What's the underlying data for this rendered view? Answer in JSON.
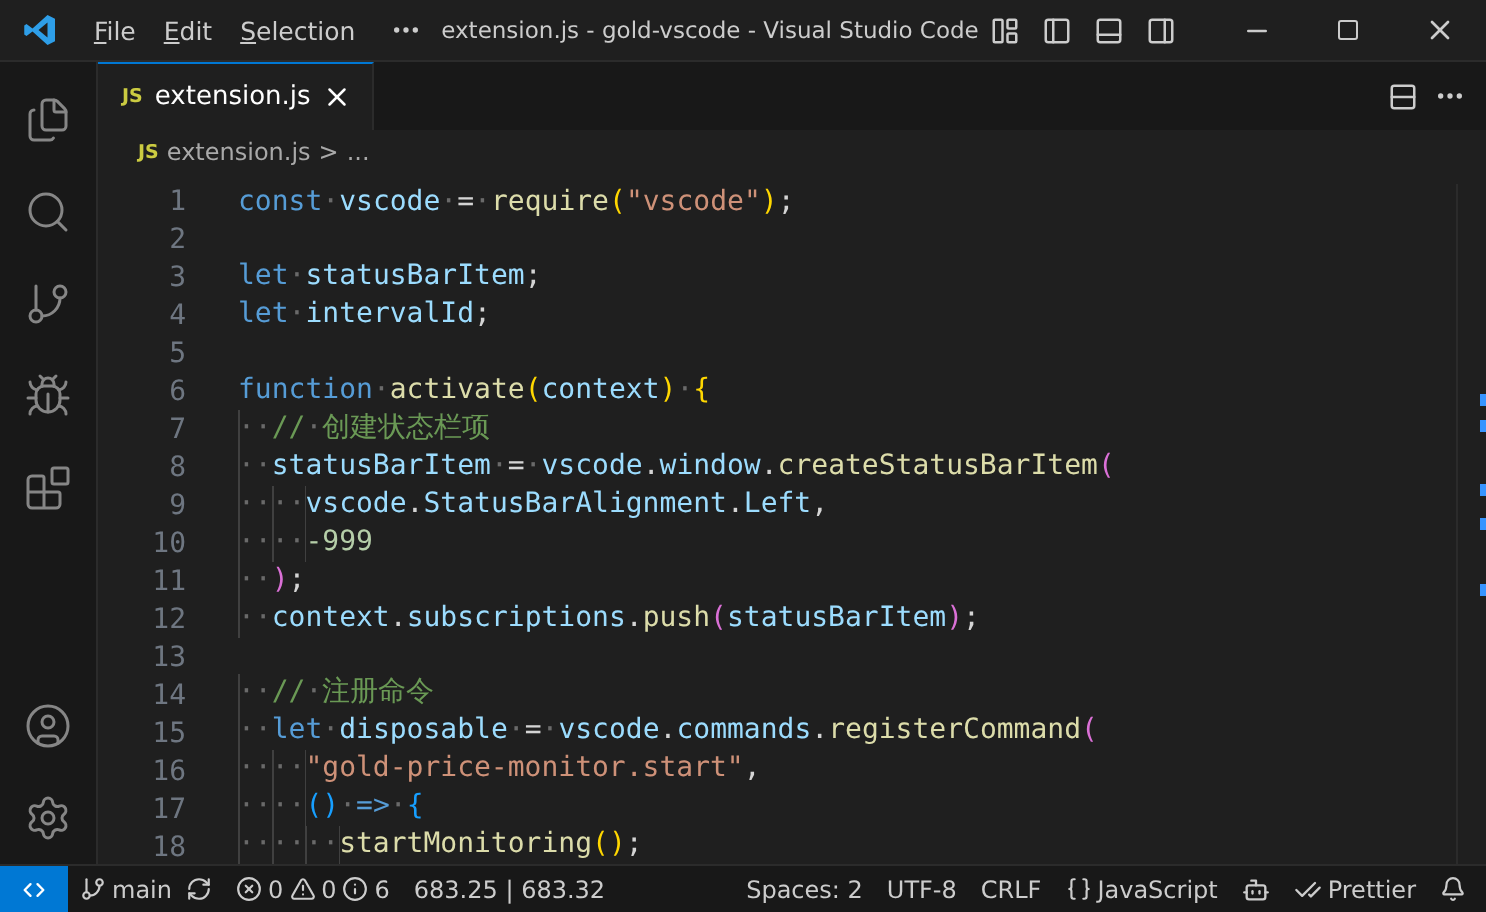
{
  "window": {
    "title": "extension.js - gold-vscode - Visual Studio Code",
    "menus": [
      "File",
      "Edit",
      "Selection"
    ]
  },
  "tabs": [
    {
      "icon_text": "JS",
      "label": "extension.js",
      "selected": true
    }
  ],
  "breadcrumb": {
    "icon_text": "JS",
    "file": "extension.js",
    "separator": ">",
    "rest": "..."
  },
  "editor": {
    "lines": [
      {
        "number": "1",
        "tokens": [
          {
            "kind": "keyword",
            "text": "const"
          },
          {
            "kind": "ws",
            "text": "·"
          },
          {
            "kind": "variable",
            "text": "vscode"
          },
          {
            "kind": "ws",
            "text": "·"
          },
          {
            "kind": "punct",
            "text": "="
          },
          {
            "kind": "ws",
            "text": "·"
          },
          {
            "kind": "function",
            "text": "require"
          },
          {
            "kind": "bracket1",
            "text": "("
          },
          {
            "kind": "string",
            "text": "\"vscode\""
          },
          {
            "kind": "bracket1",
            "text": ")"
          },
          {
            "kind": "punct",
            "text": ";"
          }
        ]
      },
      {
        "number": "2"
      },
      {
        "number": "3",
        "tokens": [
          {
            "kind": "keyword",
            "text": "let"
          },
          {
            "kind": "ws",
            "text": "·"
          },
          {
            "kind": "variable",
            "text": "statusBarItem"
          },
          {
            "kind": "punct",
            "text": ";"
          }
        ]
      },
      {
        "number": "4",
        "tokens": [
          {
            "kind": "keyword",
            "text": "let"
          },
          {
            "kind": "ws",
            "text": "·"
          },
          {
            "kind": "variable",
            "text": "intervalId"
          },
          {
            "kind": "punct",
            "text": ";"
          }
        ]
      },
      {
        "number": "5"
      },
      {
        "number": "6",
        "tokens": [
          {
            "kind": "keyword",
            "text": "function"
          },
          {
            "kind": "ws",
            "text": "·"
          },
          {
            "kind": "function",
            "text": "activate"
          },
          {
            "kind": "bracket1",
            "text": "("
          },
          {
            "kind": "variable",
            "text": "context"
          },
          {
            "kind": "bracket1",
            "text": ")"
          },
          {
            "kind": "ws",
            "text": "·"
          },
          {
            "kind": "bracket1",
            "text": "{"
          }
        ]
      },
      {
        "number": "7",
        "tokens": [
          {
            "kind": "indent",
            "text": "··"
          },
          {
            "kind": "comment",
            "text": "//"
          },
          {
            "kind": "ws",
            "text": "·"
          },
          {
            "kind": "comment",
            "text": "创建状态栏项"
          }
        ]
      },
      {
        "number": "8",
        "tokens": [
          {
            "kind": "indent",
            "text": "··"
          },
          {
            "kind": "variable",
            "text": "statusBarItem"
          },
          {
            "kind": "ws",
            "text": "·"
          },
          {
            "kind": "punct",
            "text": "="
          },
          {
            "kind": "ws",
            "text": "·"
          },
          {
            "kind": "variable",
            "text": "vscode"
          },
          {
            "kind": "punct",
            "text": "."
          },
          {
            "kind": "variable",
            "text": "window"
          },
          {
            "kind": "punct",
            "text": "."
          },
          {
            "kind": "function",
            "text": "createStatusBarItem"
          },
          {
            "kind": "bracket2",
            "text": "("
          }
        ]
      },
      {
        "number": "9",
        "tokens": [
          {
            "kind": "indent",
            "text": "····"
          },
          {
            "kind": "variable",
            "text": "vscode"
          },
          {
            "kind": "punct",
            "text": "."
          },
          {
            "kind": "variable",
            "text": "StatusBarAlignment"
          },
          {
            "kind": "punct",
            "text": "."
          },
          {
            "kind": "variable",
            "text": "Left"
          },
          {
            "kind": "punct",
            "text": ","
          }
        ]
      },
      {
        "number": "10",
        "tokens": [
          {
            "kind": "indent",
            "text": "····"
          },
          {
            "kind": "number",
            "text": "-999"
          }
        ]
      },
      {
        "number": "11",
        "tokens": [
          {
            "kind": "indent",
            "text": "··"
          },
          {
            "kind": "bracket2",
            "text": ")"
          },
          {
            "kind": "punct",
            "text": ";"
          }
        ]
      },
      {
        "number": "12",
        "tokens": [
          {
            "kind": "indent",
            "text": "··"
          },
          {
            "kind": "variable",
            "text": "context"
          },
          {
            "kind": "punct",
            "text": "."
          },
          {
            "kind": "variable",
            "text": "subscriptions"
          },
          {
            "kind": "punct",
            "text": "."
          },
          {
            "kind": "function",
            "text": "push"
          },
          {
            "kind": "bracket2",
            "text": "("
          },
          {
            "kind": "variable",
            "text": "statusBarItem"
          },
          {
            "kind": "bracket2",
            "text": ")"
          },
          {
            "kind": "punct",
            "text": ";"
          }
        ]
      },
      {
        "number": "13"
      },
      {
        "number": "14",
        "tokens": [
          {
            "kind": "indent",
            "text": "··"
          },
          {
            "kind": "comment",
            "text": "//"
          },
          {
            "kind": "ws",
            "text": "·"
          },
          {
            "kind": "comment",
            "text": "注册命令"
          }
        ]
      },
      {
        "number": "15",
        "tokens": [
          {
            "kind": "indent",
            "text": "··"
          },
          {
            "kind": "keyword",
            "text": "let"
          },
          {
            "kind": "ws",
            "text": "·"
          },
          {
            "kind": "variable",
            "text": "disposable"
          },
          {
            "kind": "ws",
            "text": "·"
          },
          {
            "kind": "punct",
            "text": "="
          },
          {
            "kind": "ws",
            "text": "·"
          },
          {
            "kind": "variable",
            "text": "vscode"
          },
          {
            "kind": "punct",
            "text": "."
          },
          {
            "kind": "variable",
            "text": "commands"
          },
          {
            "kind": "punct",
            "text": "."
          },
          {
            "kind": "function",
            "text": "registerCommand"
          },
          {
            "kind": "bracket2",
            "text": "("
          }
        ]
      },
      {
        "number": "16",
        "tokens": [
          {
            "kind": "indent",
            "text": "····"
          },
          {
            "kind": "string",
            "text": "\"gold-price-monitor.start\""
          },
          {
            "kind": "punct",
            "text": ","
          }
        ]
      },
      {
        "number": "17",
        "tokens": [
          {
            "kind": "indent",
            "text": "····"
          },
          {
            "kind": "bracket3",
            "text": "()"
          },
          {
            "kind": "ws",
            "text": "·"
          },
          {
            "kind": "keyword",
            "text": "=>"
          },
          {
            "kind": "ws",
            "text": "·"
          },
          {
            "kind": "bracket3",
            "text": "{"
          }
        ]
      },
      {
        "number": "18",
        "tokens": [
          {
            "kind": "indent",
            "text": "······"
          },
          {
            "kind": "function",
            "text": "startMonitoring"
          },
          {
            "kind": "bracket1",
            "text": "()"
          },
          {
            "kind": "punct",
            "text": ";"
          }
        ]
      }
    ]
  },
  "status_bar": {
    "branch": "main",
    "errors": "0",
    "warnings": "0",
    "infos": "6",
    "price": "683.25 | 683.32",
    "spaces": "Spaces: 2",
    "encoding": "UTF-8",
    "eol": "CRLF",
    "language": "JavaScript",
    "formatter": "Prettier"
  }
}
